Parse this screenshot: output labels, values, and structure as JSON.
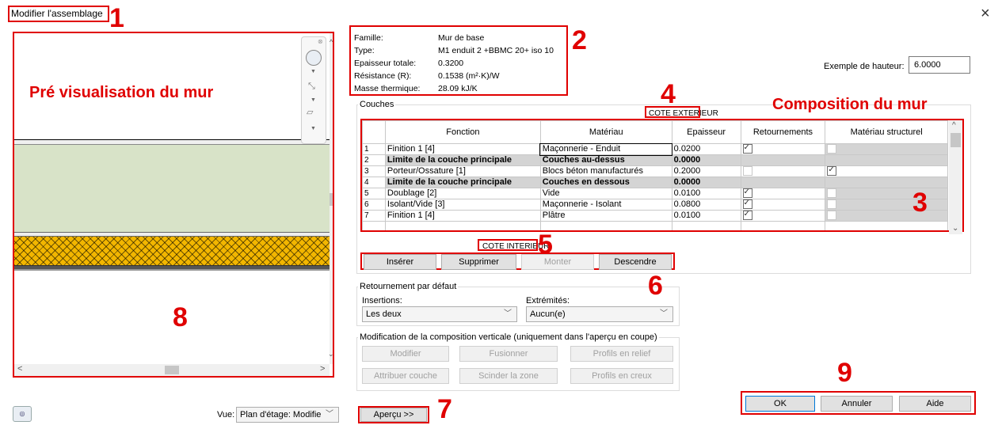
{
  "window": {
    "title": "Modifier l'assemblage",
    "close_glyph": "×"
  },
  "annotations": {
    "n1": "1",
    "n2": "2",
    "n3": "3",
    "n4": "4",
    "n5": "5",
    "n6": "6",
    "n7": "7",
    "n8": "8",
    "n9": "9",
    "preview_label": "Pré visualisation du mur",
    "composition_label": "Composition du mur"
  },
  "info": {
    "famille_label": "Famille:",
    "famille_value": "Mur de base",
    "type_label": "Type:",
    "type_value": "M1 enduit 2 +BBMC 20+ iso 10",
    "epaisseur_label": "Epaisseur totale:",
    "epaisseur_value": "0.3200",
    "resistance_label": "Résistance (R):",
    "resistance_value": "0.1538 (m²·K)/W",
    "masse_label": "Masse thermique:",
    "masse_value": "28.09 kJ/K"
  },
  "sample_height": {
    "label": "Exemple de hauteur:",
    "value": "6.0000"
  },
  "couches": {
    "group_title": "Couches",
    "exterior_label": "COTE EXTERIEUR",
    "interior_label": "COTE INTERIEUR",
    "columns": [
      "Fonction",
      "Matériau",
      "Epaisseur",
      "Retournements",
      "Matériau structurel"
    ],
    "rows": [
      {
        "num": "1",
        "fonction": "Finition 1 [4]",
        "materiau": "Maçonnerie - Enduit",
        "epaisseur": "0.0200",
        "retournements": true,
        "structurel": false,
        "bold": false
      },
      {
        "num": "2",
        "fonction": "Limite de la couche principale",
        "materiau": "Couches au-dessus",
        "epaisseur": "0.0000",
        "retournements": null,
        "structurel": null,
        "bold": true
      },
      {
        "num": "3",
        "fonction": "Porteur/Ossature [1]",
        "materiau": "Blocs béton manufacturés",
        "epaisseur": "0.2000",
        "retournements": false,
        "structurel": true,
        "bold": false
      },
      {
        "num": "4",
        "fonction": "Limite de la couche principale",
        "materiau": "Couches en dessous",
        "epaisseur": "0.0000",
        "retournements": null,
        "structurel": null,
        "bold": true
      },
      {
        "num": "5",
        "fonction": "Doublage [2]",
        "materiau": "Vide",
        "epaisseur": "0.0100",
        "retournements": true,
        "structurel": false,
        "bold": false
      },
      {
        "num": "6",
        "fonction": "Isolant/Vide [3]",
        "materiau": "Maçonnerie - Isolant",
        "epaisseur": "0.0800",
        "retournements": true,
        "structurel": false,
        "bold": false
      },
      {
        "num": "7",
        "fonction": "Finition 1 [4]",
        "materiau": "Plâtre",
        "epaisseur": "0.0100",
        "retournements": true,
        "structurel": false,
        "bold": false
      }
    ],
    "buttons": {
      "inserer": "Insérer",
      "supprimer": "Supprimer",
      "monter": "Monter",
      "descendre": "Descendre"
    }
  },
  "retournement": {
    "group_title": "Retournement par défaut",
    "insertions_label": "Insertions:",
    "insertions_value": "Les deux",
    "extremites_label": "Extrémités:",
    "extremites_value": "Aucun(e)"
  },
  "vertical": {
    "group_title": "Modification de la composition verticale (uniquement dans l'aperçu en coupe)",
    "modifier": "Modifier",
    "fusionner": "Fusionner",
    "profils_relief": "Profils en relief",
    "attribuer": "Attribuer couche",
    "scinder": "Scinder la zone",
    "profils_creux": "Profils en creux"
  },
  "bottom": {
    "vue_label": "Vue:",
    "vue_value": "Plan d'étage: Modifie",
    "apercu": "Aperçu >>",
    "ok": "OK",
    "annuler": "Annuler",
    "aide": "Aide"
  },
  "colors": {
    "annotation_red": "#e00000",
    "wall_core": "#d8e3c8",
    "hatch": "#f2b600"
  }
}
